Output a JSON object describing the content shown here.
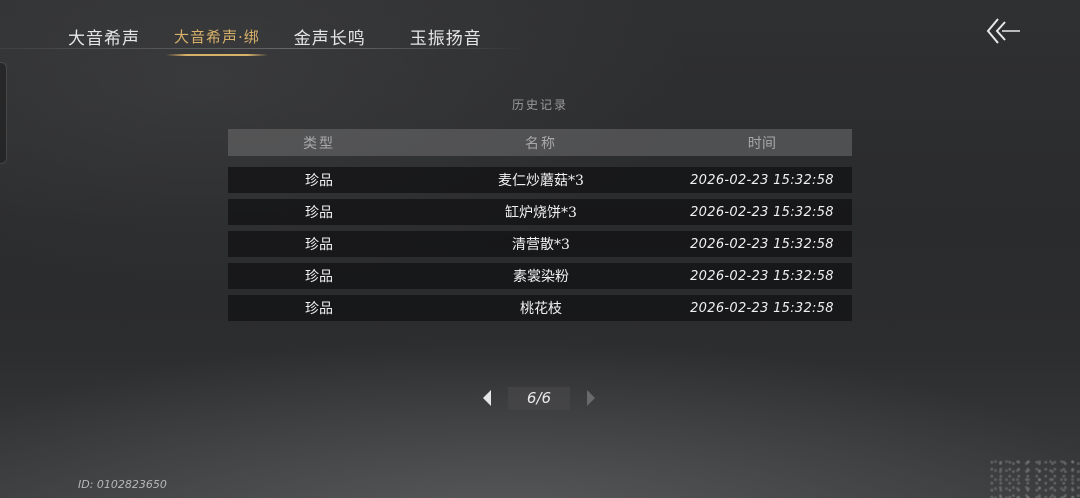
{
  "tabs": [
    {
      "label": "大音希声"
    },
    {
      "label": "大音希声·绑"
    },
    {
      "label": "金声长鸣"
    },
    {
      "label": "玉振扬音"
    }
  ],
  "active_tab_index": 1,
  "history": {
    "title": "历史记录",
    "columns": [
      "类型",
      "名称",
      "时间"
    ],
    "rows": [
      {
        "type": "珍品",
        "name": "麦仁炒蘑菇*3",
        "time": "2026-02-23 15:32:58"
      },
      {
        "type": "珍品",
        "name": "缸炉烧饼*3",
        "time": "2026-02-23 15:32:58"
      },
      {
        "type": "珍品",
        "name": "清营散*3",
        "time": "2026-02-23 15:32:58"
      },
      {
        "type": "珍品",
        "name": "素裳染粉",
        "time": "2026-02-23 15:32:58"
      },
      {
        "type": "珍品",
        "name": "桃花枝",
        "time": "2026-02-23 15:32:58"
      }
    ]
  },
  "pager": {
    "label": "6/6"
  },
  "user_id": "ID: 0102823650",
  "icons": {
    "back": "back-arrow-icon",
    "prev": "prev-page-icon",
    "next": "next-page-icon"
  },
  "colors": {
    "accent": "#d7b06a"
  }
}
